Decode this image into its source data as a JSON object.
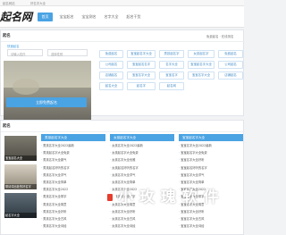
{
  "topbar": {
    "left": "起名网站",
    "right": "好名字大全"
  },
  "header": {
    "logo": "起名网",
    "nav": [
      "首页",
      "宝宝起名",
      "宝宝测名",
      "名字大全",
      "起名干货"
    ]
  },
  "form": {
    "title": "起名",
    "subtitle_left": "快速起名",
    "subtitle_right": "免费起名 · 在线测名",
    "surname_placeholder": "请输入姓氏",
    "gender_placeholder": "选择性别",
    "submit": "立即免费起名"
  },
  "categories": [
    [
      "免费起名",
      "宝宝起名字大全",
      "男孩起名字",
      "女孩起名字"
    ],
    [
      "公司起名",
      "宝宝起名名字",
      "名字大全",
      "宝宝起名字大全"
    ],
    [
      "店铺起名",
      "宝宝名字大全",
      "宝宝名字",
      "宝宝名字大全"
    ],
    [
      "起名大全",
      "起名字",
      "起名网"
    ]
  ],
  "articles": {
    "title": "起名",
    "thumbs": [
      {
        "caption": "宝宝起名大全"
      },
      {
        "caption": "带诗词出处的好名字"
      },
      {
        "caption": "起名字大全"
      }
    ],
    "columns": [
      {
        "head": "男孩起名字大全",
        "items": [
          "男孩名字大全2022最新",
          "男孩起名字大全免费",
          "男孩名字大全霸气",
          "男孩起名好听的名字",
          "男孩名字大全洋气",
          "男孩名字大全简单",
          "男孩名字大全2022",
          "男孩名字大全带字",
          "男孩名字大全寓意",
          "男孩名字大全好听",
          "男孩名字大全古风",
          "男孩名字大全诗经",
          "男孩名字大全楚辞",
          "男孩名字大全唐诗",
          "男孩名字大全宋词",
          "男孩名字大全论语"
        ]
      },
      {
        "head": "女孩起名字大全",
        "items": [
          "女孩名字大全2022最新",
          "女孩起名字大全免费",
          "女孩名字大全优雅",
          "女孩起名好听的名字",
          "女孩名字大全洋气",
          "女孩名字大全简单",
          "女孩名字大全2022",
          "女孩名字大全带字",
          "女孩名字大全寓意",
          "女孩名字大全好听",
          "女孩名字大全古风",
          "女孩名字大全诗经",
          "女孩名字大全楚辞",
          "女孩名字大全唐诗",
          "女孩名字大全宋词",
          "女孩名字大全论语"
        ]
      },
      {
        "head": "宝宝起名字大全",
        "items": [
          "宝宝名字大全2022最新",
          "宝宝起名字大全免费",
          "宝宝名字大全好听",
          "宝宝起名好听的名字",
          "宝宝名字大全洋气",
          "宝宝名字大全简单",
          "宝宝名字大全2022",
          "宝宝名字大全带字",
          "宝宝名字大全寓意",
          "宝宝名字大全好听",
          "宝宝名字大全古风",
          "宝宝名字大全诗经",
          "宝宝名字大全楚辞",
          "宝宝名字大全唐诗",
          "宝宝名字大全宋词",
          "宝宝名字大全论语"
        ]
      }
    ]
  },
  "watermark": "小 玫 瑰 软 件",
  "colors": {
    "accent": "#4aa3e3",
    "watermark_logo": "#e63d2e"
  }
}
